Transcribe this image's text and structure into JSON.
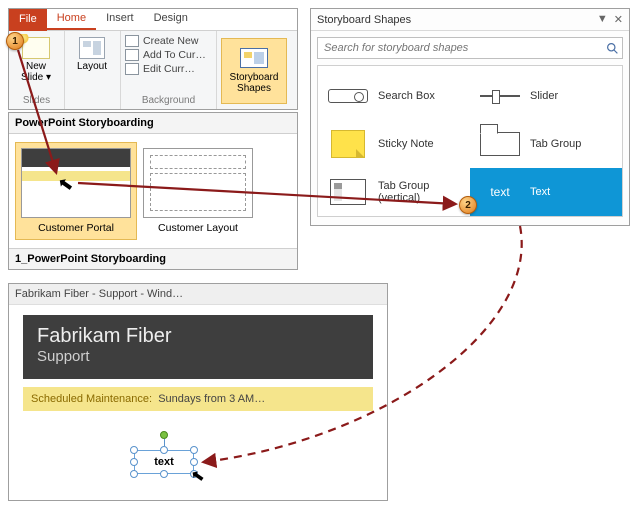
{
  "ribbon": {
    "tabs": {
      "file": "File",
      "home": "Home",
      "insert": "Insert",
      "design": "Design"
    },
    "slides_group": {
      "new_slide": "New\nSlide ▾",
      "layout": "Layout",
      "label": "Slides"
    },
    "background_group": {
      "create_new": "Create New",
      "add_to_cur": "Add To Cur…",
      "edit_curr": "Edit Curr…",
      "label": "Background"
    },
    "storyboard_btn": "Storyboard\nShapes"
  },
  "slides_panel": {
    "title": "PowerPoint Storyboarding",
    "thumb1": "Customer Portal",
    "thumb2": "Customer Layout",
    "footer": "1_PowerPoint Storyboarding"
  },
  "shapes_panel": {
    "title": "Storyboard Shapes",
    "search_placeholder": "Search for storyboard shapes",
    "items": {
      "search_box": "Search Box",
      "slider": "Slider",
      "sticky_note": "Sticky Note",
      "tab_group": "Tab Group",
      "tab_group_v": "Tab Group (vertical)",
      "text": "Text",
      "text_glyph": "text"
    }
  },
  "preview": {
    "window_title": "Fabrikam Fiber - Support - Wind…",
    "hero_line1": "Fabrikam Fiber",
    "hero_line2": "Support",
    "maintenance_label": "Scheduled Maintenance:",
    "maintenance_value": "  Sundays from 3 AM…",
    "text_shape": "text"
  },
  "steps": {
    "one": "1",
    "two": "2"
  }
}
